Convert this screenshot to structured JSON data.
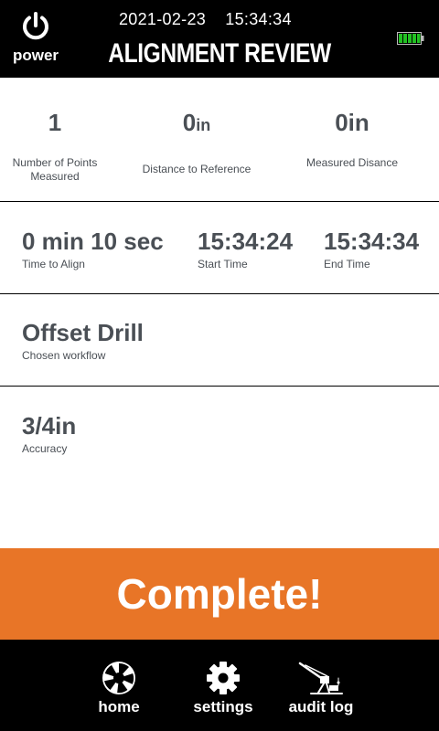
{
  "header": {
    "power_label": "power",
    "date": "2021-02-23",
    "time": "15:34:34",
    "title": "ALIGNMENT REVIEW",
    "battery_level": 1.0,
    "battery_color": "#22c122"
  },
  "summary": {
    "points": {
      "value": "1",
      "label": "Number of Points Measured"
    },
    "distance_to_reference": {
      "value": "0",
      "unit": "in",
      "label": "Distance to Reference"
    },
    "measured_distance": {
      "value": "0in",
      "label": "Measured Disance"
    }
  },
  "timing": {
    "time_to_align": {
      "value": "0 min 10 sec",
      "label": "Time to Align"
    },
    "start_time": {
      "value": "15:34:24",
      "label": "Start Time"
    },
    "end_time": {
      "value": "15:34:34",
      "label": "End Time"
    }
  },
  "workflow": {
    "value": "Offset Drill",
    "label": "Chosen workflow"
  },
  "accuracy": {
    "value": "3/4in",
    "label": "Accuracy"
  },
  "complete_button": {
    "label": "Complete!",
    "color": "#e87527"
  },
  "nav": {
    "home": {
      "label": "home",
      "icon": "aperture-home-icon"
    },
    "settings": {
      "label": "settings",
      "icon": "gear-icon"
    },
    "audit_log": {
      "label": "audit log",
      "icon": "drill-rig-icon"
    }
  }
}
